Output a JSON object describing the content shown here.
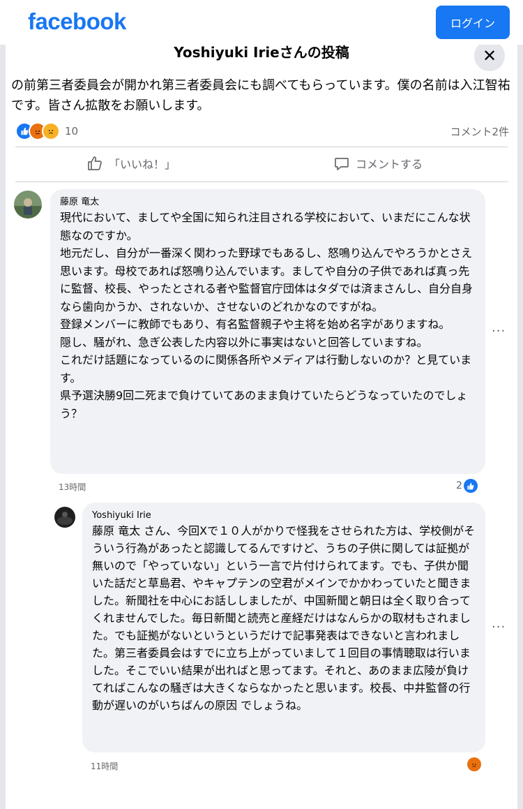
{
  "header": {
    "logo": "facebook",
    "login_label": "ログイン"
  },
  "modal": {
    "title": "Yoshiyuki Irieさんの投稿",
    "close_label": "✕"
  },
  "post": {
    "body": "の前第三者委員会が開かれ第三者委員会にも調べてもらっています。僕の名前は入江智祐です。皆さん拡散をお願いします。",
    "reaction_count": "10",
    "reaction_types": [
      "like-icon",
      "angry-icon",
      "sad-icon"
    ],
    "comment_count": "コメント2件"
  },
  "actions": {
    "like_label": "「いいね！」",
    "comment_label": "コメントする"
  },
  "comments": [
    {
      "author": "藤原 竜太",
      "text": "現代において、ましてや全国に知られ注目される学校において、いまだにこんな状態なのですか。\n地元だし、自分が一番深く関わった野球でもあるし、怒鳴り込んでやろうかとさえ思います。母校であれば怒鳴り込んでいます。ましてや自分の子供であれば真っ先に監督、校長、やったとされる者や監督官庁団体はタダでは済まさんし、自分自身なら歯向かうか、されないか、させないのどれかなのですがね。\n登録メンバーに教師でもあり、有名監督親子や主将を始め名字がありますね。\n隠し、騒がれ、急ぎ公表した内容以外に事実はないと回答していますね。\nこれだけ話題になっているのに関係各所やメディアは行動しないのか？と見ています。\n県予選決勝9回二死まで負けていてあのまま負けていたらどうなっていたのでしょう？",
      "time": "13時間",
      "reaction_count": "2"
    },
    {
      "author": "Yoshiyuki Irie",
      "text": "藤原 竜太 さん、今回Xで１０人がかりで怪我をさせられた方は、学校側がそういう行為があったと認識してるんですけど、うちの子供に関しては証拠が無いので「やっていない」という一言で片付けられてます。でも、子供か聞いた話だと草島君、やキャプテンの空君がメインでかかわっていたと聞きました。新聞社を中心にお話ししましたが、中国新聞と朝日は全く取り合ってくれませんでした。毎日新聞と読売と産経だけはなんらかの取材もされました。でも証拠がないというというだけで記事発表はできないと言われました。第三者委員会はすでに立ち上がっていまして１回目の事情聴取は行いました。そこでいい結果が出ればと思ってます。それと、あのまま広陵が負けてればこんなの騒ぎは大きくならなかったと思います。校長、中井監督の行動が遅いのがいちばんの原因 でしょうね。",
      "time": "11時間"
    }
  ],
  "colors": {
    "brand": "#1877f2",
    "bubble": "#f0f2f5",
    "secondary_text": "#65676b"
  }
}
